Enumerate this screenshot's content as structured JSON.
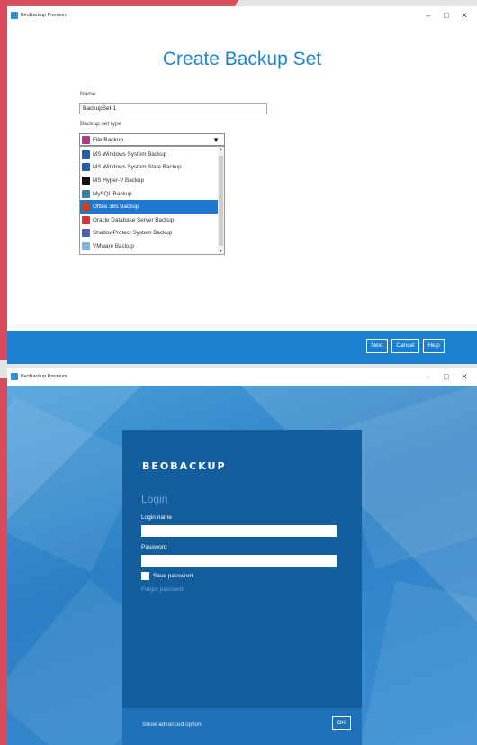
{
  "window1": {
    "app_title": "BeoBackup Premium",
    "heading": "Create Backup Set",
    "name_label": "Name",
    "name_value": "BackupSet-1",
    "type_label": "Backup set type",
    "selected_type": "File Backup",
    "options": [
      {
        "label": "MS Windows System Backup",
        "icon": "windows-system-icon",
        "color": "#1f5fb0"
      },
      {
        "label": "MS Windows System State Backup",
        "icon": "windows-state-icon",
        "color": "#1f5fb0"
      },
      {
        "label": "MS Hyper-V Backup",
        "icon": "hyperv-icon",
        "color": "#111111"
      },
      {
        "label": "MySQL Backup",
        "icon": "mysql-icon",
        "color": "#3a7fa8"
      },
      {
        "label": "Office 365 Backup",
        "icon": "office365-icon",
        "color": "#d83b01"
      },
      {
        "label": "Oracle Database Server Backup",
        "icon": "oracle-icon",
        "color": "#d6333b"
      },
      {
        "label": "ShadowProtect System Backup",
        "icon": "shadowprotect-icon",
        "color": "#4a5fb6"
      },
      {
        "label": "VMware Backup",
        "icon": "vmware-icon",
        "color": "#7fb3e0"
      }
    ],
    "selected_option_index": 4,
    "buttons": {
      "next": "Next",
      "cancel": "Cancel",
      "help": "Help"
    }
  },
  "window2": {
    "app_title": "BeoBackup Premium",
    "logo": "BEOBACKUP",
    "heading": "Login",
    "login_name_label": "Login name",
    "login_name_value": "",
    "password_label": "Password",
    "password_value": "",
    "save_password_label": "Save password",
    "forgot_password": "Forgot password",
    "advanced_option": "Show advanced option",
    "ok_label": "OK"
  },
  "window_controls": {
    "minimize": "–",
    "maximize": "□",
    "close": "✕"
  },
  "colors": {
    "accent": "#1d7fcf",
    "panel": "#155e9d",
    "backdrop": "#d84c5c"
  }
}
